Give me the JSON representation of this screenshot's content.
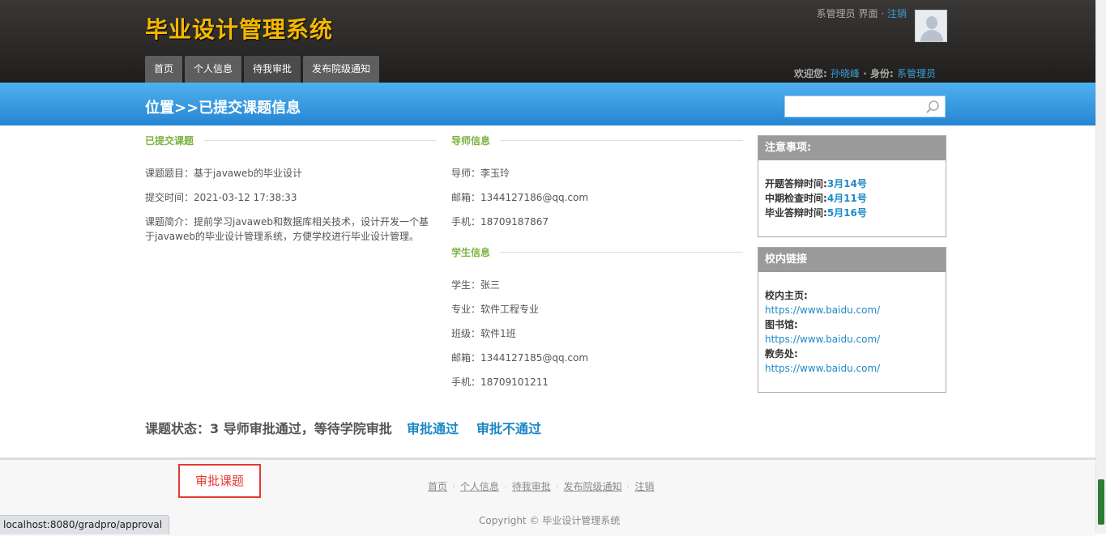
{
  "header": {
    "logo": "毕业设计管理系统",
    "role_interface": "系管理员 界面",
    "logout_sep": "·",
    "logout": "注销",
    "nav": [
      "首页",
      "个人信息",
      "待我审批",
      "发布院级通知"
    ],
    "welcome_label": "欢迎您:",
    "user_name": "孙晓峰",
    "identity_label": "· 身份:",
    "identity": "系管理员"
  },
  "bluebar": {
    "breadcrumb": "位置>>已提交课题信息",
    "search_placeholder": ""
  },
  "topic": {
    "section_title": "已提交课题",
    "title": "课题题目：基于javaweb的毕业设计",
    "submit_time": "提交时间：2021-03-12 17:38:33",
    "intro": "课题简介：提前学习javaweb和数据库相关技术，设计开发一个基于javaweb的毕业设计管理系统，方便学校进行毕业设计管理。"
  },
  "teacher": {
    "section_title": "导师信息",
    "name": "导师：李玉玲",
    "email": "邮箱：1344127186@qq.com",
    "phone": "手机：18709187867"
  },
  "student": {
    "section_title": "学生信息",
    "name": "学生：张三",
    "major": "专业：软件工程专业",
    "class": "班级：软件1班",
    "email": "邮箱：1344127185@qq.com",
    "phone": "手机：18709101211"
  },
  "status": {
    "text": "课题状态：3 导师审批通过，等待学院审批",
    "approve": "审批通过",
    "reject": "审批不通过"
  },
  "notice": {
    "title": "注意事项:",
    "items": [
      {
        "label": "开题答辩时间:",
        "value": "3月14号"
      },
      {
        "label": "中期检查时间:",
        "value": "4月11号"
      },
      {
        "label": "毕业答辩时间:",
        "value": "5月16号"
      }
    ]
  },
  "links": {
    "title": "校内链接",
    "items": [
      {
        "label": "校内主页:",
        "url": "https://www.baidu.com/"
      },
      {
        "label": "图书馆:",
        "url": "https://www.baidu.com/"
      },
      {
        "label": "教务处:",
        "url": "https://www.baidu.com/"
      }
    ]
  },
  "footer": {
    "nav": [
      "首页",
      "个人信息",
      "待我审批",
      "发布院级通知",
      "注销"
    ],
    "copyright": "Copyright © 毕业设计管理系统",
    "annotation": "审批课题",
    "status_url": "localhost:8080/gradpro/approval"
  },
  "colors": {
    "accent_blue": "#2585d3",
    "logo_yellow": "#f5b800",
    "section_green": "#7cb342",
    "link_blue": "#1e88c7",
    "annotation_red": "#e53935"
  }
}
